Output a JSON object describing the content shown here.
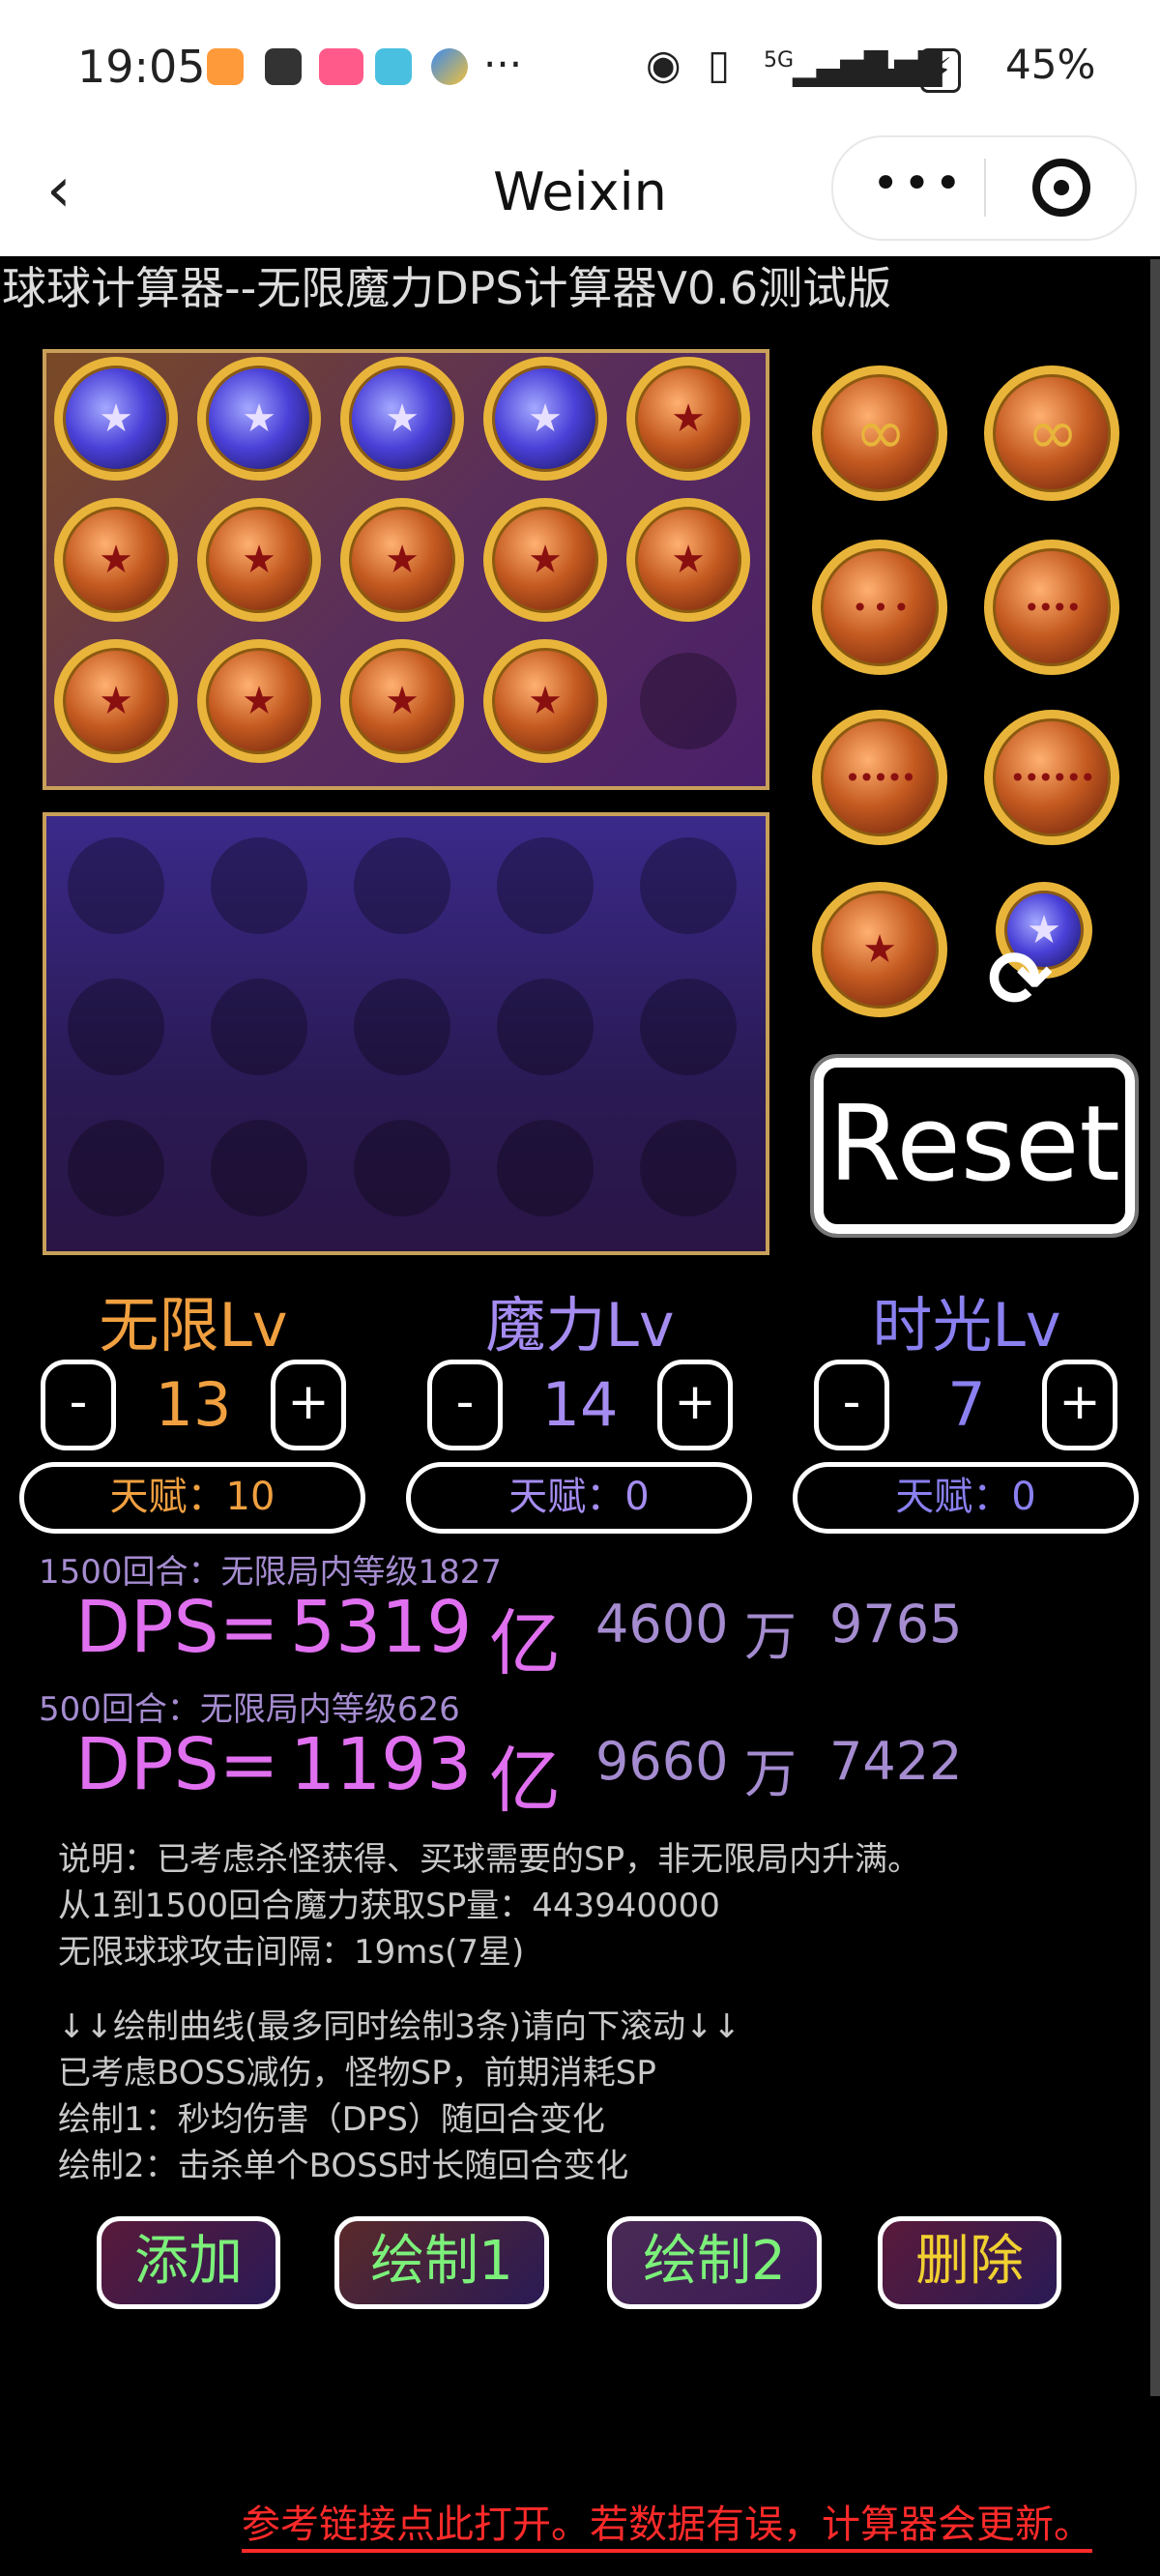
{
  "status_bar": {
    "time": "19:05",
    "app_icons": [
      "tasks-icon",
      "upload-icon",
      "bilibili-icon",
      "book-icon",
      "pinwheel-icon"
    ],
    "more": "···",
    "network": "5G",
    "battery": "45%"
  },
  "navbar": {
    "title": "Weixin",
    "more": "•••"
  },
  "app": {
    "title": "球球计算器--无限魔力DPS计算器V0.6测试版"
  },
  "board_top": {
    "rows": [
      [
        "magic",
        "magic",
        "magic",
        "magic",
        "infinite"
      ],
      [
        "infinite",
        "infinite",
        "infinite",
        "infinite",
        "infinite"
      ],
      [
        "infinite",
        "infinite",
        "infinite",
        "infinite",
        "empty"
      ]
    ]
  },
  "palette": {
    "items": [
      "infinite-plain",
      "infinite-plain",
      "infinite-dots3",
      "infinite-dots4",
      "infinite-dots5",
      "infinite-dots6",
      "infinite-star",
      "magic-refresh"
    ]
  },
  "reset_label": "Reset",
  "levels": [
    {
      "title": "无限Lv",
      "value": "13",
      "talent": "天赋：10",
      "color": "#f0a040",
      "minus": "-",
      "plus": "+"
    },
    {
      "title": "魔力Lv",
      "value": "14",
      "talent": "天赋：0",
      "color": "#a58cf0",
      "minus": "-",
      "plus": "+"
    },
    {
      "title": "时光Lv",
      "value": "7",
      "talent": "天赋：0",
      "color": "#8a80f0",
      "minus": "-",
      "plus": "+"
    }
  ],
  "results": [
    {
      "label": "1500回合：无限局内等级1827",
      "dps_prefix": "DPS=",
      "yi": "5319",
      "yi_unit": "亿",
      "wan": "4600",
      "wan_unit": "万",
      "rest": "9765"
    },
    {
      "label": "500回合：无限局内等级626",
      "dps_prefix": "DPS=",
      "yi": "1193",
      "yi_unit": "亿",
      "wan": "9660",
      "wan_unit": "万",
      "rest": "7422"
    }
  ],
  "notes_a": [
    "说明：已考虑杀怪获得、买球需要的SP，非无限局内升满。",
    "从1到1500回合魔力获取SP量：443940000",
    "无限球球攻击间隔：19ms(7星)"
  ],
  "notes_b": [
    "↓↓绘制曲线(最多同时绘制3条)请向下滚动↓↓",
    "已考虑BOSS减伤，怪物SP，前期消耗SP",
    "绘制1：秒均伤害（DPS）随回合变化",
    "绘制2：击杀单个BOSS时长随回合变化"
  ],
  "actions": {
    "add": "添加",
    "draw1": "绘制1",
    "draw2": "绘制2",
    "delete": "删除"
  },
  "footer": "参考链接点此打开。若数据有误，计算器会更新。"
}
